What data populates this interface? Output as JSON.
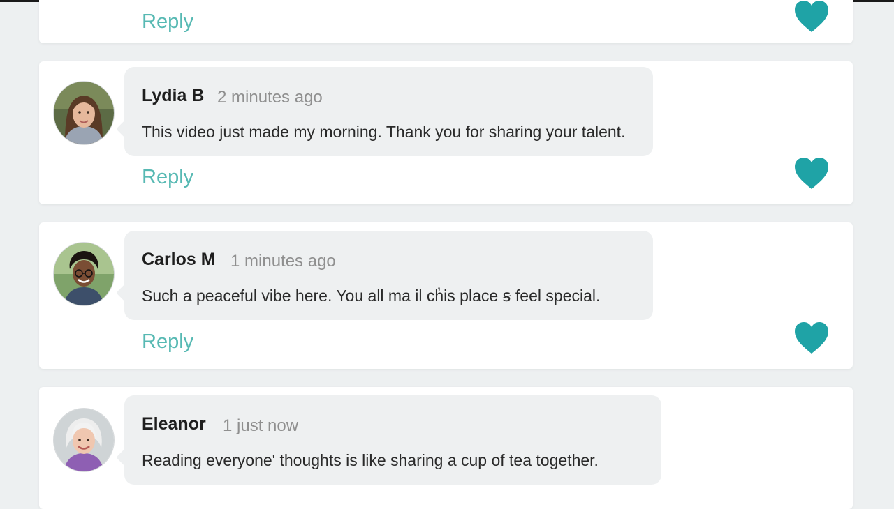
{
  "colors": {
    "accent": "#57b9b3",
    "heart": "#1fa3a6",
    "bubble": "#eef0f1",
    "page_background": "#edf0f1"
  },
  "comments": [
    {
      "partial": true,
      "reply_label": "Reply",
      "like_icon": "heart-icon"
    },
    {
      "name": "Lydia B",
      "time": "2 minutes ago",
      "text": "This video just made my morning. Thank you for sharing your talent.",
      "reply_label": "Reply",
      "like_icon": "heart-icon",
      "avatar_icon": "avatar-woman-brown-hair"
    },
    {
      "name": "Carlos M",
      "time": "1 minutes ago",
      "text": "Such a peaceful vibe here. You all ma il ch̓is place ꞩ feel special.",
      "reply_label": "Reply",
      "like_icon": "heart-icon",
      "avatar_icon": "avatar-man-glasses"
    },
    {
      "name": "Eleanor",
      "time": "1 just  now",
      "text": "Reading everyone' thoughts is like sharing a cup of tea together.",
      "avatar_icon": "avatar-elderly-woman"
    }
  ]
}
